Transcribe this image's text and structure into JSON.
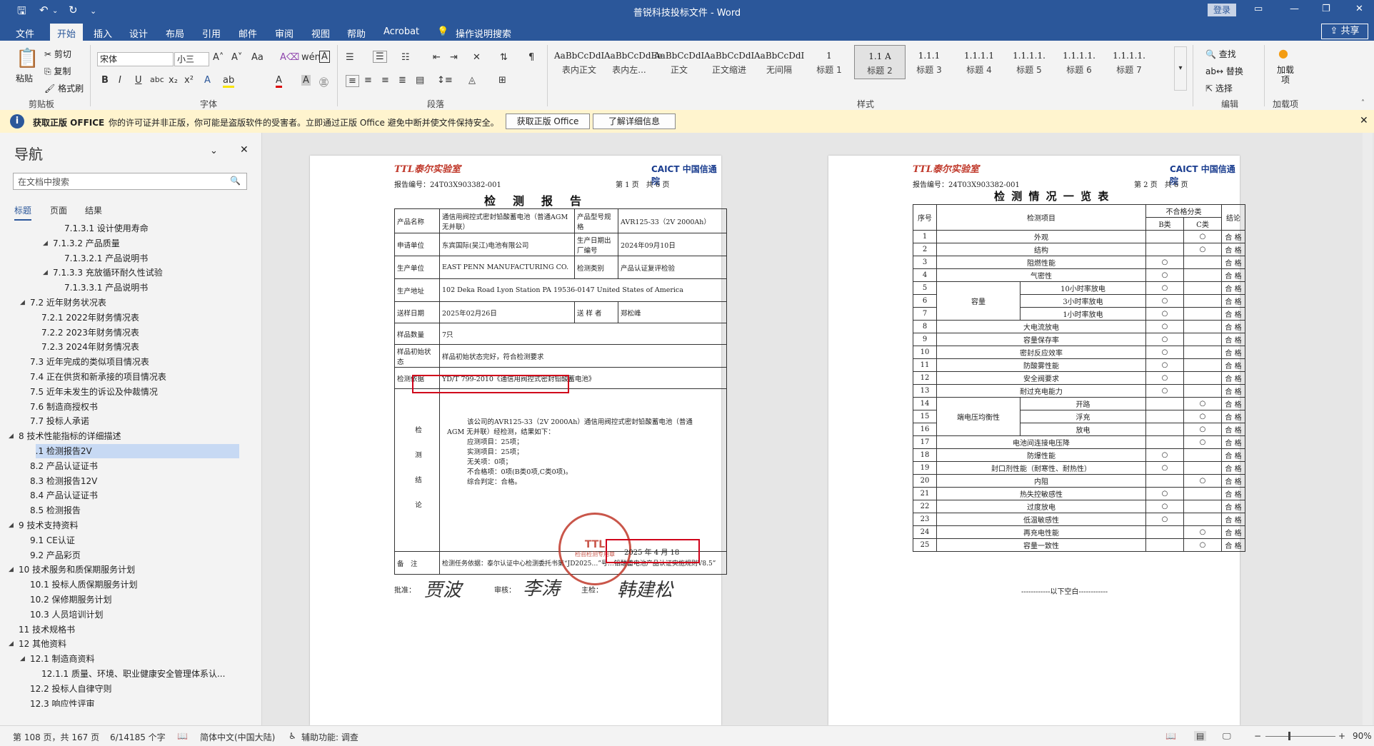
{
  "window": {
    "title": "普锐科技投标文件 - Word",
    "login_label": "登录",
    "share_label": "共享"
  },
  "menu": {
    "tabs": [
      "文件",
      "开始",
      "插入",
      "设计",
      "布局",
      "引用",
      "邮件",
      "审阅",
      "视图",
      "帮助",
      "Acrobat"
    ],
    "search_label": "操作说明搜索"
  },
  "ribbon": {
    "clipboard": {
      "paste": "粘贴",
      "cut": "剪切",
      "copy": "复制",
      "format_painter": "格式刷",
      "label": "剪贴板"
    },
    "font": {
      "name": "宋体",
      "size": "小三",
      "label": "字体"
    },
    "paragraph": {
      "label": "段落"
    },
    "styles": {
      "label": "样式",
      "items": [
        {
          "sample": "AaBbCcDdI",
          "name": "表内正文"
        },
        {
          "sample": "AaBbCcDdEe",
          "name": "表内左..."
        },
        {
          "sample": "AaBbCcDdI",
          "name": "正文"
        },
        {
          "sample": "AaBbCcDdI",
          "name": "正文缩进"
        },
        {
          "sample": "AaBbCcDdI",
          "name": "无间隔"
        },
        {
          "sample": "1",
          "name": "标题 1"
        },
        {
          "sample": "1.1 A",
          "name": "标题 2"
        },
        {
          "sample": "1.1.1",
          "name": "标题 3"
        },
        {
          "sample": "1.1.1.1",
          "name": "标题 4"
        },
        {
          "sample": "1.1.1.1.",
          "name": "标题 5"
        },
        {
          "sample": "1.1.1.1.",
          "name": "标题 6"
        },
        {
          "sample": "1.1.1.1.",
          "name": "标题 7"
        }
      ]
    },
    "editing": {
      "find": "查找",
      "replace": "替换",
      "select": "选择",
      "label": "编辑"
    },
    "addins": {
      "label": "加载项",
      "button": "加载项"
    }
  },
  "warning": {
    "bold": "获取正版 OFFICE",
    "message": "你的许可证并非正版，你可能是盗版软件的受害者。立即通过正版 Office 避免中断并使文件保持安全。",
    "btn_get": "获取正版 Office",
    "btn_more": "了解详细信息"
  },
  "nav": {
    "title": "导航",
    "search_placeholder": "在文档中搜索",
    "tabs": [
      "标题",
      "页面",
      "结果"
    ],
    "items": [
      {
        "level": 5,
        "text": "7.1.3.1 设计使用寿命",
        "toggle": ""
      },
      {
        "level": 4,
        "text": "7.1.3.2 产品质量",
        "toggle": "◢"
      },
      {
        "level": 5,
        "text": "7.1.3.2.1 产品说明书",
        "toggle": ""
      },
      {
        "level": 4,
        "text": "7.1.3.3 充放循环耐久性试验",
        "toggle": "◢"
      },
      {
        "level": 5,
        "text": "7.1.3.3.1 产品说明书",
        "toggle": ""
      },
      {
        "level": 2,
        "text": "7.2 近年财务状况表",
        "toggle": "◢"
      },
      {
        "level": 3,
        "text": "7.2.1 2022年财务情况表",
        "toggle": ""
      },
      {
        "level": 3,
        "text": "7.2.2 2023年财务情况表",
        "toggle": ""
      },
      {
        "level": 3,
        "text": "7.2.3 2024年财务情况表",
        "toggle": ""
      },
      {
        "level": 2,
        "text": "7.3 近年完成的类似项目情况表",
        "toggle": ""
      },
      {
        "level": 2,
        "text": "7.4 正在供货和新承接的项目情况表",
        "toggle": ""
      },
      {
        "level": 2,
        "text": "7.5 近年未发生的诉讼及仲裁情况",
        "toggle": ""
      },
      {
        "level": 2,
        "text": "7.6 制造商授权书",
        "toggle": ""
      },
      {
        "level": 2,
        "text": "7.7 投标人承诺",
        "toggle": ""
      },
      {
        "level": 1,
        "text": "8 技术性能指标的详细描述",
        "toggle": "◢"
      },
      {
        "level": 2,
        "text": "8.1 检测报告2V",
        "toggle": "",
        "selected": true
      },
      {
        "level": 2,
        "text": "8.2 产品认证证书",
        "toggle": ""
      },
      {
        "level": 2,
        "text": "8.3 检测报告12V",
        "toggle": ""
      },
      {
        "level": 2,
        "text": "8.4 产品认证证书",
        "toggle": ""
      },
      {
        "level": 2,
        "text": "8.5 检测报告",
        "toggle": ""
      },
      {
        "level": 1,
        "text": "9 技术支持资料",
        "toggle": "◢"
      },
      {
        "level": 2,
        "text": "9.1 CE认证",
        "toggle": ""
      },
      {
        "level": 2,
        "text": "9.2 产品彩页",
        "toggle": ""
      },
      {
        "level": 1,
        "text": "10 技术服务和质保期服务计划",
        "toggle": "◢"
      },
      {
        "level": 2,
        "text": "10.1 投标人质保期服务计划",
        "toggle": ""
      },
      {
        "level": 2,
        "text": "10.2 保修期服务计划",
        "toggle": ""
      },
      {
        "level": 2,
        "text": "10.3 人员培训计划",
        "toggle": ""
      },
      {
        "level": 1,
        "text": "11 技术规格书",
        "toggle": ""
      },
      {
        "level": 1,
        "text": "12 其他资料",
        "toggle": "◢"
      },
      {
        "level": 2,
        "text": "12.1 制造商资料",
        "toggle": "◢"
      },
      {
        "level": 3,
        "text": "12.1.1 质量、环境、职业健康安全管理体系认...",
        "toggle": ""
      },
      {
        "level": 2,
        "text": "12.2 投标人自律守则",
        "toggle": ""
      },
      {
        "level": 2,
        "text": "12.3 响应性评审",
        "toggle": ""
      }
    ]
  },
  "ruler_numbers": [
    "6",
    "4",
    "2",
    "",
    "2",
    "4",
    "6",
    "8",
    "10",
    "12",
    "14",
    "16",
    "18",
    "20",
    "22",
    "24",
    "26",
    "28",
    "30",
    "32",
    "34",
    "36",
    "38",
    "40",
    "",
    "44",
    "46",
    "48"
  ],
  "page1": {
    "logo_ttl": "TTL泰尔实验室",
    "logo_caict": "CAICT 中国信通院",
    "report_no": "报告编号：24T03X903382-001",
    "page_info": "第 1 页　共 6 页",
    "heading": "检　测　报　告",
    "rows": {
      "product_name_label": "产品名称",
      "product_name": "通信用阀控式密封铅酸蓄电池（普通AGM 无并联）",
      "model_label": "产品型号规　格",
      "model": "AVR125-33（2V 2000Ah）",
      "applicant_label": "申请单位",
      "applicant": "东宾国际(吴江)电池有限公司",
      "prod_date_label": "生产日期出厂编号",
      "prod_date": "2024年09月10日",
      "manufacturer_label": "生产单位",
      "manufacturer": "EAST PENN MANUFACTURING CO.",
      "test_type_label": "检测类别",
      "test_type": "产品认证复评检验",
      "address_label": "生产地址",
      "address": "102 Deka Road Lyon Station PA 19536-0147 United States of America",
      "send_date_label": "送样日期",
      "send_date": "2025年02月26日",
      "sender_label": "送 样 者",
      "sender": "郑松峰",
      "qty_label": "样品数量",
      "qty": "7只",
      "init_state_label": "样品初始状　态",
      "init_state": "样品初始状态完好，符合检测要求",
      "basis_label": "检测依据",
      "basis": "YD/T 799-2010《通信用阀控式密封铅酸蓄电池》",
      "conclusion_label": "检　测　结　论",
      "conclusion_lines": [
        "该公司的AVR125-33（2V 2000Ah）通信用阀控式密封铅酸蓄电池（普通",
        "AGM 无并联）经检测，结果如下：",
        "应测项目：25项；",
        "实测项目：25项；",
        "无关项：0项；",
        "不合格项：0项(B类0项,C类0项)。",
        "综合判定：合格。"
      ],
      "stamp_text": "检验检测专用章",
      "sign_date": "2025 年 4 月 18",
      "note_label": "备　注",
      "note": "检测任务依据：泰尔认证中心检测委托书第“JD2025…”号…铅酸蓄电池产品认证实施规则V8.5”"
    },
    "signatures": {
      "approve_label": "批准：",
      "approve": "贾波",
      "review_label": "审核：",
      "review": "李涛",
      "main_label": "主检：",
      "main": "韩建松"
    }
  },
  "page2": {
    "logo_ttl": "TTL泰尔实验室",
    "logo_caict": "CAICT 中国信通院",
    "report_no": "报告编号：24T03X903382-001",
    "page_info": "第 2 页　共 6 页",
    "heading": "检 测 情 况 一 览 表",
    "headers": {
      "no": "序号",
      "item": "检测项目",
      "fail_class": "不合格分类",
      "b": "B类",
      "c": "C类",
      "result": "结论"
    },
    "rows": [
      {
        "no": "1",
        "group": "",
        "item": "外观",
        "b": "",
        "c": "○",
        "res": "合 格"
      },
      {
        "no": "2",
        "group": "",
        "item": "结构",
        "b": "",
        "c": "○",
        "res": "合 格"
      },
      {
        "no": "3",
        "group": "",
        "item": "阻燃性能",
        "b": "○",
        "c": "",
        "res": "合 格"
      },
      {
        "no": "4",
        "group": "",
        "item": "气密性",
        "b": "○",
        "c": "",
        "res": "合 格"
      },
      {
        "no": "5",
        "group": "容量",
        "item": "10小时率放电",
        "b": "○",
        "c": "",
        "res": "合 格"
      },
      {
        "no": "6",
        "group": "容量",
        "item": "3小时率放电",
        "b": "○",
        "c": "",
        "res": "合 格"
      },
      {
        "no": "7",
        "group": "容量",
        "item": "1小时率放电",
        "b": "○",
        "c": "",
        "res": "合 格"
      },
      {
        "no": "8",
        "group": "",
        "item": "大电流放电",
        "b": "○",
        "c": "",
        "res": "合 格"
      },
      {
        "no": "9",
        "group": "",
        "item": "容量保存率",
        "b": "○",
        "c": "",
        "res": "合 格"
      },
      {
        "no": "10",
        "group": "",
        "item": "密封反应效率",
        "b": "○",
        "c": "",
        "res": "合 格"
      },
      {
        "no": "11",
        "group": "",
        "item": "防酸雾性能",
        "b": "○",
        "c": "",
        "res": "合 格"
      },
      {
        "no": "12",
        "group": "",
        "item": "安全阀要求",
        "b": "○",
        "c": "",
        "res": "合 格"
      },
      {
        "no": "13",
        "group": "",
        "item": "耐过充电能力",
        "b": "○",
        "c": "",
        "res": "合 格"
      },
      {
        "no": "14",
        "group": "端电压均衡性",
        "item": "开路",
        "b": "",
        "c": "○",
        "res": "合 格"
      },
      {
        "no": "15",
        "group": "端电压均衡性",
        "item": "浮充",
        "b": "",
        "c": "○",
        "res": "合 格"
      },
      {
        "no": "16",
        "group": "端电压均衡性",
        "item": "放电",
        "b": "",
        "c": "○",
        "res": "合 格"
      },
      {
        "no": "17",
        "group": "",
        "item": "电池间连接电压降",
        "b": "",
        "c": "○",
        "res": "合 格"
      },
      {
        "no": "18",
        "group": "",
        "item": "防爆性能",
        "b": "○",
        "c": "",
        "res": "合 格"
      },
      {
        "no": "19",
        "group": "",
        "item": "封口剂性能（耐寒性、耐热性）",
        "b": "○",
        "c": "",
        "res": "合 格"
      },
      {
        "no": "20",
        "group": "",
        "item": "内阻",
        "b": "",
        "c": "○",
        "res": "合 格"
      },
      {
        "no": "21",
        "group": "",
        "item": "热失控敏感性",
        "b": "○",
        "c": "",
        "res": "合 格"
      },
      {
        "no": "22",
        "group": "",
        "item": "过度放电",
        "b": "○",
        "c": "",
        "res": "合 格"
      },
      {
        "no": "23",
        "group": "",
        "item": "低温敏感性",
        "b": "○",
        "c": "",
        "res": "合 格"
      },
      {
        "no": "24",
        "group": "",
        "item": "再充电性能",
        "b": "",
        "c": "○",
        "res": "合 格"
      },
      {
        "no": "25",
        "group": "",
        "item": "容量一致性",
        "b": "",
        "c": "○",
        "res": "合 格"
      }
    ],
    "footer": "------------以下空白------------"
  },
  "status": {
    "page": "第 108 页，共 167 页",
    "words": "6/14185 个字",
    "lang": "简体中文(中国大陆)",
    "accessibility": "辅助功能: 调查",
    "zoom": "90%"
  }
}
